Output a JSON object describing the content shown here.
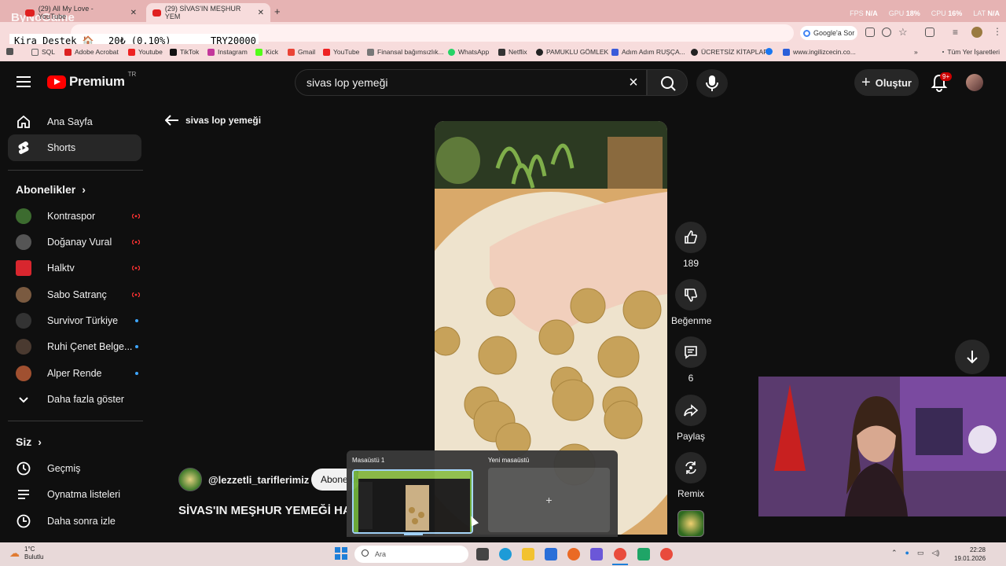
{
  "browser": {
    "tabs": [
      {
        "label": "(29) All My Love - YouTube"
      },
      {
        "label": "(29) SİVAS'IN MEŞHUR YEM"
      }
    ],
    "stats": {
      "fps_label": "FPS",
      "fps": "N/A",
      "gpu_label": "GPU",
      "gpu": "18%",
      "cpu_label": "CPU",
      "cpu": "16%",
      "lat_label": "LAT",
      "lat": "N/A"
    },
    "google_sor": "Google'a Sor",
    "bookmarks": [
      "SQL",
      "Adobe Acrobat",
      "Youtube",
      "TikTok",
      "Instagram",
      "Kick",
      "Gmail",
      "YouTube",
      "Finansal bağımsızlık...",
      "WhatsApp",
      "Netflix",
      "PAMUKLU GÖMLEK",
      "Adım Adım RUŞÇA...",
      "ÜCRETSİZ KİTAPLAR",
      "",
      "www.ingilizcecin.co..."
    ],
    "all_bookmarks": "Tüm Yer İşaretleri"
  },
  "overlay": {
    "brand": "ByNoGame",
    "kira_label": "Kira Destek 🏠",
    "kira_amount": "20₺ (0.10%)",
    "kira_goal": "TRY20000"
  },
  "header": {
    "logo_text": "Premium",
    "country": "TR",
    "search_value": "sivas lop yemeği",
    "create_label": "Oluştur",
    "notification_count": "9+"
  },
  "sidebar": {
    "home": "Ana Sayfa",
    "shorts": "Shorts",
    "subscriptions_title": "Abonelikler",
    "subscriptions": [
      {
        "name": "Kontraspor",
        "status": "live",
        "color": "#3c6b2f"
      },
      {
        "name": "Doğanay Vural",
        "status": "live",
        "color": "#555555"
      },
      {
        "name": "Halktv",
        "status": "live",
        "color": "#d8262e"
      },
      {
        "name": "Sabo Satranç",
        "status": "live",
        "color": "#7a5a40"
      },
      {
        "name": "Survivor Türkiye",
        "status": "new",
        "color": "#333333"
      },
      {
        "name": "Ruhi Çenet Belge...",
        "status": "new",
        "color": "#4a3a30"
      },
      {
        "name": "Alper Rende",
        "status": "new",
        "color": "#a05030"
      }
    ],
    "show_more": "Daha fazla göster",
    "you_title": "Siz",
    "history": "Geçmiş",
    "playlists": "Oynatma listeleri",
    "watch_later": "Daha sonra izle"
  },
  "main": {
    "back_label": "sivas lop yemeği",
    "likes": "189",
    "dislike_label": "Beğenme",
    "comments": "6",
    "share_label": "Paylaş",
    "remix_label": "Remix",
    "channel": "@lezzetli_tariflerimiz",
    "subscribe_label": "Abone ol",
    "title": "SİVAS'IN MEŞHUR YEMEĞİ HANGİSİ"
  },
  "taskview": {
    "desktop1": "Masaüstü 1",
    "desktop2": "Yeni masaüstü",
    "add": "+"
  },
  "taskbar": {
    "temp": "1°C",
    "weather": "Bulutlu",
    "search_placeholder": "Ara",
    "time": "22:28",
    "date": "19.01.2026"
  }
}
